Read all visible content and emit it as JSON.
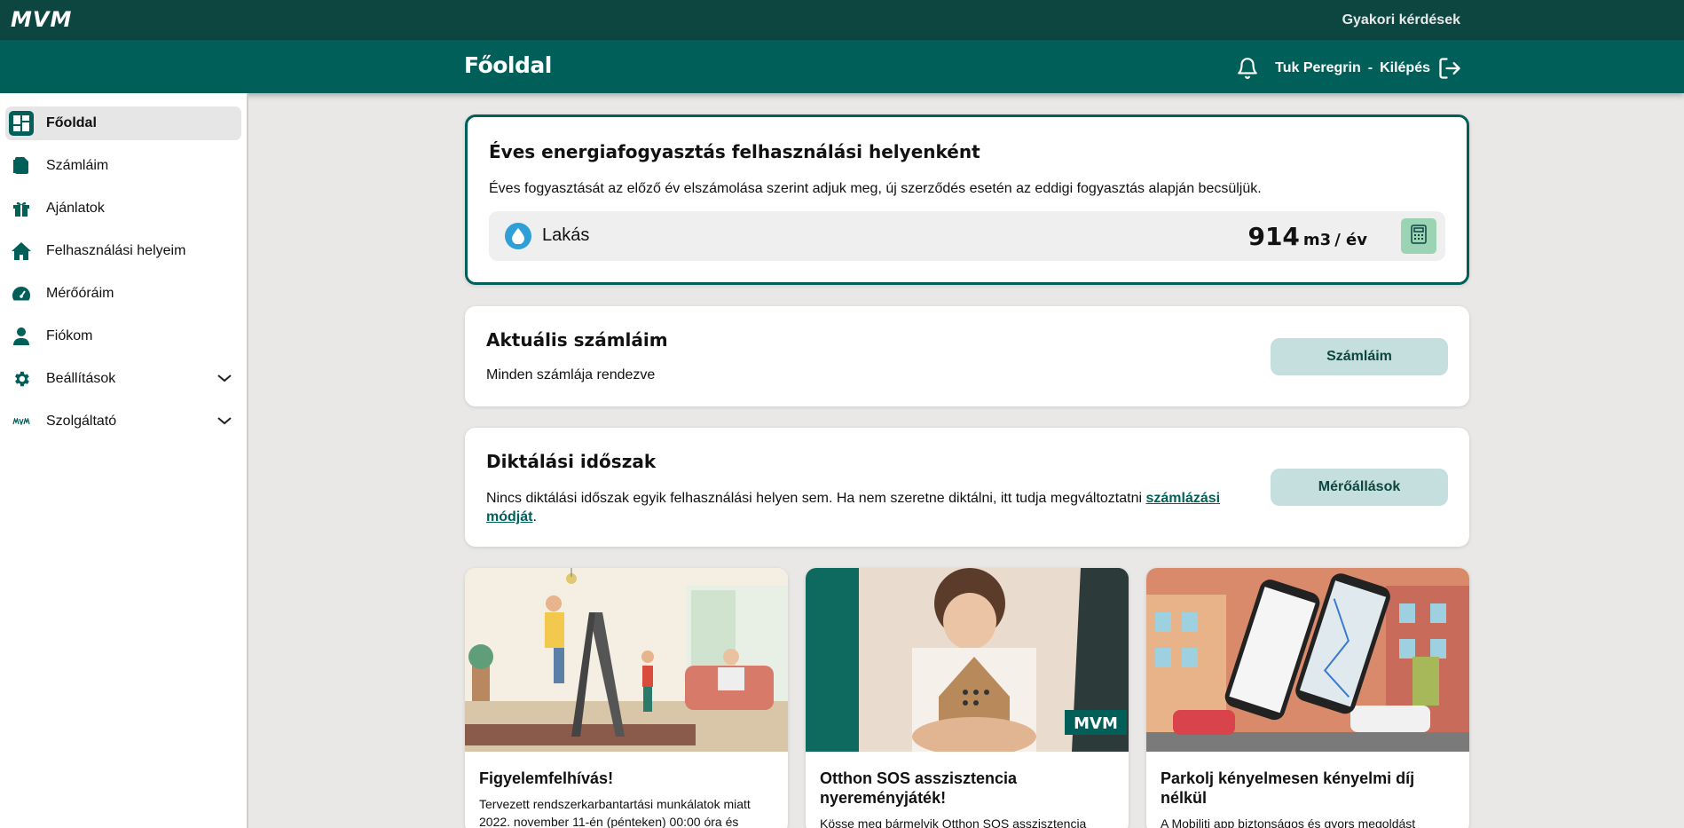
{
  "brand": {
    "logo": "MVM",
    "accent": "#006059",
    "topbar": "#0d4540"
  },
  "topbar": {
    "faq": "Gyakori kérdések"
  },
  "header": {
    "title": "Főoldal",
    "user": "Tuk Peregrin",
    "separator": "-",
    "logout": "Kilépés"
  },
  "sidebar": {
    "items": [
      {
        "label": "Főoldal",
        "icon": "dashboard-icon",
        "active": true
      },
      {
        "label": "Számláim",
        "icon": "document-icon"
      },
      {
        "label": "Ajánlatok",
        "icon": "gift-icon"
      },
      {
        "label": "Felhasználási helyeim",
        "icon": "home-icon"
      },
      {
        "label": "Mérőóráim",
        "icon": "meter-icon"
      },
      {
        "label": "Fiókom",
        "icon": "user-icon"
      },
      {
        "label": "Beállítások",
        "icon": "gear-icon",
        "expandable": true
      },
      {
        "label": "Szolgáltató",
        "icon": "mvm-logo-icon",
        "expandable": true
      }
    ]
  },
  "energy": {
    "title": "Éves energiafogyasztás felhasználási helyenként",
    "description": "Éves fogyasztását az előző év elszámolása szerint adjuk meg, új szerződés esetén az eddigi fogyasztás alapján becsüljük.",
    "place": "Lakás",
    "value": "914",
    "unit": "m3",
    "per": "/ év"
  },
  "bills": {
    "title": "Aktuális számláim",
    "text": "Minden számlája rendezve",
    "button": "Számláim"
  },
  "diktalas": {
    "title": "Diktálási időszak",
    "text": "Nincs diktálási időszak egyik felhasználási helyen sem. Ha nem szeretne diktálni, itt tudja megváltoztatni ",
    "link": "számlázási módját",
    "suffix": ".",
    "button": "Mérőállások"
  },
  "promos": [
    {
      "title": "Figyelemfelhívás!",
      "text": "Tervezett rendszerkarbantartási munkálatok miatt 2022. november 11-én (pénteken) 00:00 óra és"
    },
    {
      "title": "Otthon SOS asszisztencia nyereményjáték!",
      "text": "Kösse meg bármelyik Otthon SOS asszisztencia",
      "badge": "MVM"
    },
    {
      "title": "Parkolj kényelmesen kényelmi díj nélkül",
      "text": "A Mobiliti app biztonságos és gyors megoldást"
    }
  ]
}
